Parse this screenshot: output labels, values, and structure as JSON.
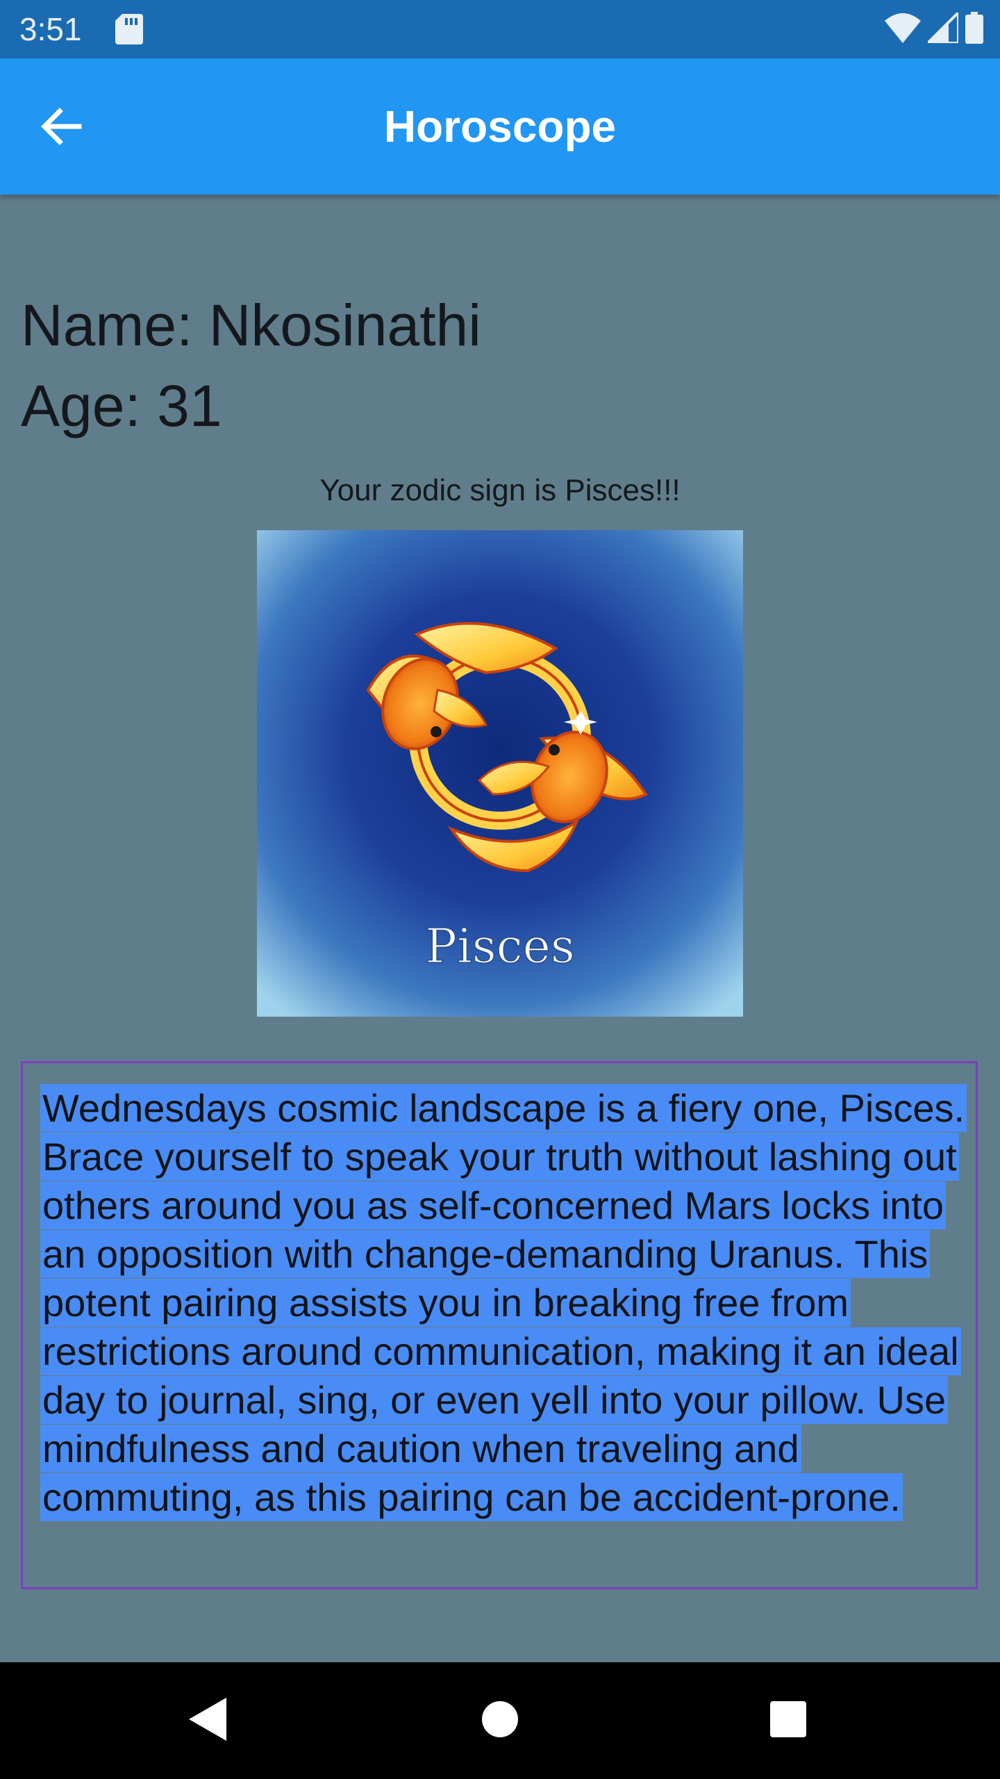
{
  "status_bar": {
    "time": "3:51",
    "icons": [
      "sd-card-icon",
      "wifi-icon",
      "cell-signal-icon",
      "battery-icon"
    ]
  },
  "app_bar": {
    "title": "Horoscope",
    "back_icon": "arrow-back-icon"
  },
  "profile": {
    "name_line": "Name: Nkosinathi",
    "age_line": "Age: 31"
  },
  "zodiac": {
    "caption": "Your zodic sign is Pisces!!!",
    "image_label": "Pisces"
  },
  "horoscope": {
    "text": "Wednesdays cosmic landscape is a fiery one, Pisces. Brace yourself to speak your truth without lashing out others around you as self-concerned Mars locks into an opposition with change-demanding Uranus. This potent pairing assists you in breaking free from restrictions around communication, making it an ideal day to journal, sing, or even yell into your pillow. Use mindfulness and caution when traveling and commuting, as this pairing can be accident-prone."
  },
  "nav_bar": {
    "buttons": [
      "nav-back-icon",
      "nav-home-icon",
      "nav-recents-icon"
    ]
  },
  "colors": {
    "status_bar": "#1b6bb2",
    "app_bar": "#2196f3",
    "background": "#607d8b",
    "text_highlight": "#4a8cf5",
    "box_border": "#7b3fc4"
  }
}
